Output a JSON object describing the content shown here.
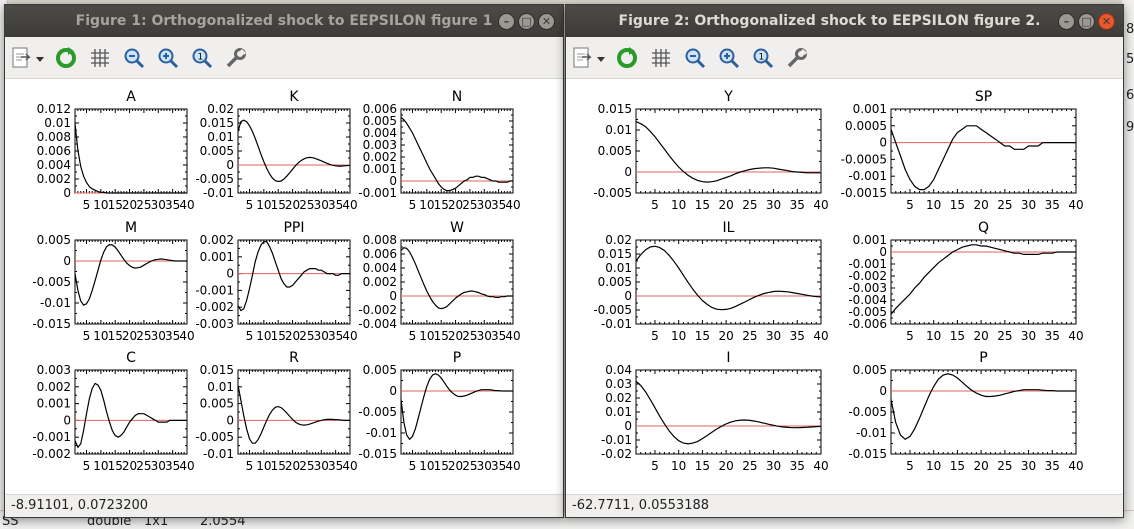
{
  "background": {
    "bottom_text": [
      "SS",
      "double",
      "1x1",
      "2.0554"
    ],
    "right_digits": [
      "8",
      "5",
      "6",
      "9"
    ]
  },
  "windows": [
    {
      "id": "fig1",
      "title": "Figure 1: Orthogonalized shock to EEPSILON figure 1",
      "status": "-8.91101,  0.0723200",
      "active": false
    },
    {
      "id": "fig2",
      "title": "Figure 2: Orthogonalized shock to EEPSILON figure 2.",
      "status": "-62.7711,  0.0553188",
      "active": true
    }
  ],
  "toolbar_icons": [
    "export-icon",
    "dropdown-arrow-icon",
    "refresh-icon",
    "grid-icon",
    "zoom-out-icon",
    "zoom-in-icon",
    "zoom-reset-icon",
    "settings-wrench-icon"
  ],
  "colors": {
    "response": "#000000",
    "zero_line": "#e06060"
  },
  "chart_data": [
    {
      "figure": 1,
      "title": "A",
      "type": "line",
      "x": [
        1,
        40
      ],
      "ylim": [
        0,
        0.012
      ],
      "yticks": [
        "0.012",
        "0.01",
        "0.008",
        "0.006",
        "0.004",
        "0.002",
        "0"
      ],
      "xticks": [
        "5",
        "10",
        "15",
        "20",
        "25",
        "30",
        "35",
        "40"
      ],
      "values": [
        0.0099,
        0.0061,
        0.0038,
        0.0024,
        0.0015,
        0.0009,
        0.0006,
        0.0004,
        0.0002,
        0.0001,
        0.0001,
        0.0,
        0.0,
        0.0,
        0.0,
        0.0,
        0.0,
        0.0,
        0.0,
        0.0,
        0.0,
        0.0,
        0.0,
        0.0,
        0.0,
        0.0,
        0.0,
        0.0,
        0.0,
        0.0,
        0.0,
        0.0,
        0.0,
        0.0,
        0.0,
        0.0,
        0.0,
        0.0,
        0.0,
        0.0
      ]
    },
    {
      "figure": 1,
      "title": "K",
      "type": "line",
      "ylim": [
        -0.01,
        0.02
      ],
      "yticks": [
        "0.02",
        "0.015",
        "0.01",
        "0.005",
        "0",
        "-0.005",
        "-0.01"
      ],
      "xticks": [
        "5",
        "10",
        "15",
        "20",
        "25",
        "30",
        "35",
        "40"
      ],
      "values": [
        0.012,
        0.0155,
        0.016,
        0.0155,
        0.014,
        0.012,
        0.0095,
        0.0067,
        0.0038,
        0.0012,
        -0.0012,
        -0.0032,
        -0.0047,
        -0.0056,
        -0.0059,
        -0.0057,
        -0.005,
        -0.004,
        -0.0028,
        -0.0015,
        -0.0003,
        0.0008,
        0.0016,
        0.0022,
        0.0026,
        0.0027,
        0.0026,
        0.0023,
        0.0019,
        0.0015,
        0.001,
        0.0006,
        0.0002,
        -0.0001,
        -0.0003,
        -0.0004,
        -0.0004,
        -0.0003,
        -0.0002,
        -0.0001
      ]
    },
    {
      "figure": 1,
      "title": "N",
      "type": "line",
      "ylim": [
        -0.001,
        0.006
      ],
      "yticks": [
        "0.006",
        "0.005",
        "0.004",
        "0.003",
        "0.002",
        "0.001",
        "0",
        "-0.001"
      ],
      "xticks": [
        "5",
        "10",
        "15",
        "20",
        "25",
        "30",
        "35",
        "40"
      ],
      "values": [
        0.0053,
        0.0051,
        0.0048,
        0.0044,
        0.004,
        0.0035,
        0.003,
        0.0025,
        0.002,
        0.0015,
        0.001,
        0.0006,
        0.0002,
        -0.0002,
        -0.0005,
        -0.0007,
        -0.0008,
        -0.0008,
        -0.0007,
        -0.0006,
        -0.0004,
        -0.0002,
        0.0,
        0.0001,
        0.0003,
        0.0003,
        0.0004,
        0.0004,
        0.0003,
        0.0003,
        0.0002,
        0.0001,
        0.0,
        0.0,
        -0.0001,
        -0.0001,
        -0.0001,
        -0.0001,
        0.0,
        0.0
      ]
    },
    {
      "figure": 1,
      "title": "M",
      "type": "line",
      "ylim": [
        -0.015,
        0.005
      ],
      "yticks": [
        "0.005",
        "0",
        "-0.005",
        "-0.01",
        "-0.015"
      ],
      "xticks": [
        "5",
        "10",
        "15",
        "20",
        "25",
        "30",
        "35",
        "40"
      ],
      "values": [
        -0.003,
        -0.007,
        -0.0095,
        -0.0105,
        -0.0102,
        -0.009,
        -0.007,
        -0.0047,
        -0.0022,
        0.0002,
        0.0021,
        0.0034,
        0.0039,
        0.0038,
        0.0033,
        0.0024,
        0.0014,
        0.0004,
        -0.0005,
        -0.0011,
        -0.0015,
        -0.0017,
        -0.0016,
        -0.0014,
        -0.001,
        -0.0006,
        -0.0002,
        0.0001,
        0.0003,
        0.0004,
        0.0005,
        0.0004,
        0.0003,
        0.0002,
        0.0001,
        0.0,
        0.0,
        0.0,
        0.0,
        0.0
      ]
    },
    {
      "figure": 1,
      "title": "PPI",
      "type": "line",
      "ylim": [
        -0.003,
        0.002
      ],
      "yticks": [
        "0.002",
        "0.001",
        "0",
        "-0.001",
        "-0.002",
        "-0.003"
      ],
      "xticks": [
        "5",
        "10",
        "15",
        "20",
        "25",
        "30",
        "35",
        "40"
      ],
      "values": [
        -0.0019,
        -0.0022,
        -0.0021,
        -0.0016,
        -0.0009,
        -0.0001,
        0.0007,
        0.0013,
        0.0017,
        0.0019,
        0.0019,
        0.0016,
        0.0012,
        0.0007,
        0.0002,
        -0.0003,
        -0.0006,
        -0.0008,
        -0.0008,
        -0.0007,
        -0.0005,
        -0.0003,
        -0.0001,
        0.0001,
        0.0002,
        0.0003,
        0.0003,
        0.0003,
        0.0002,
        0.0002,
        0.0001,
        0.0,
        0.0,
        0.0,
        -0.0001,
        -0.0001,
        0.0,
        0.0,
        0.0,
        0.0
      ]
    },
    {
      "figure": 1,
      "title": "W",
      "type": "line",
      "ylim": [
        -0.004,
        0.008
      ],
      "yticks": [
        "0.008",
        "0.006",
        "0.004",
        "0.002",
        "0",
        "-0.002",
        "-0.004"
      ],
      "xticks": [
        "5",
        "10",
        "15",
        "20",
        "25",
        "30",
        "35",
        "40"
      ],
      "values": [
        0.0065,
        0.0069,
        0.0068,
        0.0063,
        0.0055,
        0.0046,
        0.0036,
        0.0026,
        0.0016,
        0.0007,
        -0.0001,
        -0.0008,
        -0.0013,
        -0.0017,
        -0.0018,
        -0.0017,
        -0.0015,
        -0.0011,
        -0.0007,
        -0.0003,
        0.0,
        0.0003,
        0.0005,
        0.0006,
        0.0007,
        0.0007,
        0.0006,
        0.0005,
        0.0003,
        0.0002,
        0.0,
        -0.0001,
        -0.0001,
        -0.0002,
        -0.0002,
        -0.0001,
        -0.0001,
        0.0,
        0.0,
        0.0
      ]
    },
    {
      "figure": 1,
      "title": "C",
      "type": "line",
      "ylim": [
        -0.002,
        0.003
      ],
      "yticks": [
        "0.003",
        "0.002",
        "0.001",
        "0",
        "-0.001",
        "-0.002"
      ],
      "xticks": [
        "5",
        "10",
        "15",
        "20",
        "25",
        "30",
        "35",
        "40"
      ],
      "values": [
        -0.0012,
        -0.0016,
        -0.0014,
        -0.0006,
        0.0004,
        0.0013,
        0.0019,
        0.0022,
        0.0021,
        0.0018,
        0.0012,
        0.0005,
        -0.0001,
        -0.0006,
        -0.0009,
        -0.001,
        -0.0009,
        -0.0007,
        -0.0004,
        -0.0001,
        0.0001,
        0.0003,
        0.0004,
        0.0004,
        0.0004,
        0.0003,
        0.0002,
        0.0001,
        0.0,
        -0.0001,
        -0.0001,
        -0.0001,
        -0.0001,
        0.0,
        0.0,
        0.0,
        0.0,
        0.0,
        0.0,
        0.0
      ]
    },
    {
      "figure": 1,
      "title": "R",
      "type": "line",
      "ylim": [
        -0.01,
        0.015
      ],
      "yticks": [
        "0.015",
        "0.01",
        "0.005",
        "0",
        "-0.005",
        "-0.01"
      ],
      "xticks": [
        "5",
        "10",
        "15",
        "20",
        "25",
        "30",
        "35",
        "40"
      ],
      "values": [
        0.0105,
        0.006,
        0.0015,
        -0.0025,
        -0.0055,
        -0.0068,
        -0.0068,
        -0.0057,
        -0.004,
        -0.002,
        0.0,
        0.0018,
        0.0031,
        0.0039,
        0.0041,
        0.0038,
        0.0031,
        0.0022,
        0.0012,
        0.0003,
        -0.0005,
        -0.001,
        -0.0013,
        -0.0014,
        -0.0013,
        -0.0011,
        -0.0008,
        -0.0005,
        -0.0002,
        0.0,
        0.0002,
        0.0003,
        0.0003,
        0.0003,
        0.0002,
        0.0002,
        0.0001,
        0.0,
        0.0,
        0.0
      ]
    },
    {
      "figure": 1,
      "title": "P",
      "type": "line",
      "ylim": [
        -0.015,
        0.005
      ],
      "yticks": [
        "0.005",
        "0",
        "-0.005",
        "-0.01",
        "-0.015"
      ],
      "xticks": [
        "5",
        "10",
        "15",
        "20",
        "25",
        "30",
        "35",
        "40"
      ],
      "values": [
        -0.002,
        -0.0075,
        -0.0105,
        -0.0115,
        -0.0108,
        -0.009,
        -0.0065,
        -0.0038,
        -0.0012,
        0.0011,
        0.0028,
        0.0038,
        0.0041,
        0.0038,
        0.0031,
        0.0021,
        0.0011,
        0.0002,
        -0.0005,
        -0.001,
        -0.0013,
        -0.0013,
        -0.0012,
        -0.001,
        -0.0007,
        -0.0004,
        -0.0001,
        0.0001,
        0.0003,
        0.0003,
        0.0003,
        0.0003,
        0.0002,
        0.0001,
        0.0001,
        0.0,
        0.0,
        0.0,
        0.0,
        0.0
      ]
    },
    {
      "figure": 2,
      "title": "Y",
      "type": "line",
      "ylim": [
        -0.005,
        0.015
      ],
      "yticks": [
        "0.015",
        "0.01",
        "0.005",
        "0",
        "-0.005"
      ],
      "xticks": [
        "5",
        "10",
        "15",
        "20",
        "25",
        "30",
        "35",
        "40"
      ],
      "values": [
        0.012,
        0.0115,
        0.0108,
        0.0097,
        0.0084,
        0.0069,
        0.0054,
        0.0039,
        0.0025,
        0.0012,
        0.0001,
        -0.0008,
        -0.0015,
        -0.002,
        -0.0023,
        -0.0024,
        -0.0023,
        -0.0021,
        -0.0017,
        -0.0013,
        -0.0009,
        -0.0004,
        0.0,
        0.0003,
        0.0006,
        0.0008,
        0.0009,
        0.001,
        0.001,
        0.0009,
        0.0007,
        0.0005,
        0.0003,
        0.0001,
        0.0,
        -0.0001,
        -0.0002,
        -0.0002,
        -0.0002,
        -0.0002
      ]
    },
    {
      "figure": 2,
      "title": "SP",
      "type": "line",
      "ylim": [
        -0.0015,
        0.001
      ],
      "yticks": [
        "0.001",
        "0.0005",
        "0",
        "-0.0005",
        "-0.001",
        "-0.0015"
      ],
      "xticks": [
        "5",
        "10",
        "15",
        "20",
        "25",
        "30",
        "35",
        "40"
      ],
      "values": [
        0.0004,
        0.0,
        -0.0004,
        -0.0008,
        -0.0011,
        -0.0013,
        -0.0014,
        -0.0014,
        -0.0013,
        -0.0011,
        -0.0008,
        -0.0005,
        -0.0002,
        0.0001,
        0.0003,
        0.0004,
        0.0005,
        0.0005,
        0.0005,
        0.0004,
        0.0003,
        0.0002,
        0.0001,
        0.0,
        -0.0001,
        -0.0001,
        -0.0002,
        -0.0002,
        -0.0002,
        -0.0001,
        -0.0001,
        -0.0001,
        0.0,
        0.0,
        0.0,
        0.0,
        0.0,
        0.0,
        0.0,
        0.0
      ]
    },
    {
      "figure": 2,
      "title": "IL",
      "type": "line",
      "ylim": [
        -0.01,
        0.02
      ],
      "yticks": [
        "0.02",
        "0.015",
        "0.01",
        "0.005",
        "0",
        "-0.005",
        "-0.01"
      ],
      "xticks": [
        "5",
        "10",
        "15",
        "20",
        "25",
        "30",
        "35",
        "40"
      ],
      "values": [
        0.0125,
        0.0148,
        0.0165,
        0.0175,
        0.0178,
        0.0173,
        0.0162,
        0.0145,
        0.0124,
        0.01,
        0.0074,
        0.0048,
        0.0024,
        0.0002,
        -0.0016,
        -0.003,
        -0.0041,
        -0.0047,
        -0.0049,
        -0.0048,
        -0.0044,
        -0.0037,
        -0.0029,
        -0.0021,
        -0.0012,
        -0.0004,
        0.0003,
        0.0009,
        0.0013,
        0.0016,
        0.0017,
        0.0016,
        0.0015,
        0.0012,
        0.0009,
        0.0006,
        0.0003,
        0.0,
        -0.0002,
        -0.0003
      ]
    },
    {
      "figure": 2,
      "title": "Q",
      "type": "line",
      "ylim": [
        -0.006,
        0.001
      ],
      "yticks": [
        "0.001",
        "0",
        "-0.001",
        "-0.002",
        "-0.003",
        "-0.004",
        "-0.005",
        "-0.006"
      ],
      "xticks": [
        "5",
        "10",
        "15",
        "20",
        "25",
        "30",
        "35",
        "40"
      ],
      "values": [
        -0.0052,
        -0.0047,
        -0.0043,
        -0.0039,
        -0.0035,
        -0.003,
        -0.0026,
        -0.0021,
        -0.0017,
        -0.0013,
        -0.0009,
        -0.0006,
        -0.0003,
        0.0,
        0.0002,
        0.0004,
        0.0005,
        0.0006,
        0.0006,
        0.0005,
        0.0005,
        0.0004,
        0.0003,
        0.0002,
        0.0001,
        0.0,
        -0.0001,
        -0.0001,
        -0.0002,
        -0.0002,
        -0.0002,
        -0.0002,
        -0.0001,
        -0.0001,
        -0.0001,
        0.0,
        0.0,
        0.0,
        0.0,
        0.0
      ]
    },
    {
      "figure": 2,
      "title": "I",
      "type": "line",
      "ylim": [
        -0.02,
        0.04
      ],
      "yticks": [
        "0.04",
        "0.03",
        "0.02",
        "0.01",
        "0",
        "-0.01",
        "-0.02"
      ],
      "xticks": [
        "5",
        "10",
        "15",
        "20",
        "25",
        "30",
        "35",
        "40"
      ],
      "values": [
        0.032,
        0.029,
        0.0245,
        0.019,
        0.013,
        0.007,
        0.0015,
        -0.0035,
        -0.0075,
        -0.0105,
        -0.0122,
        -0.0128,
        -0.0122,
        -0.011,
        -0.009,
        -0.0068,
        -0.0045,
        -0.0022,
        -0.0002,
        0.0015,
        0.0028,
        0.0037,
        0.0042,
        0.0043,
        0.004,
        0.0035,
        0.0028,
        0.002,
        0.0012,
        0.0005,
        -0.0002,
        -0.0007,
        -0.001,
        -0.0012,
        -0.0012,
        -0.0011,
        -0.0009,
        -0.0007,
        -0.0004,
        -0.0002
      ]
    },
    {
      "figure": 2,
      "title": "P",
      "type": "line",
      "ylim": [
        -0.015,
        0.005
      ],
      "yticks": [
        "0.005",
        "0",
        "-0.005",
        "-0.01",
        "-0.015"
      ],
      "xticks": [
        "5",
        "10",
        "15",
        "20",
        "25",
        "30",
        "35",
        "40"
      ],
      "values": [
        -0.002,
        -0.0075,
        -0.0105,
        -0.0115,
        -0.0108,
        -0.009,
        -0.0065,
        -0.0038,
        -0.0012,
        0.0011,
        0.0028,
        0.0038,
        0.0041,
        0.0038,
        0.0031,
        0.0021,
        0.0011,
        0.0002,
        -0.0005,
        -0.001,
        -0.0013,
        -0.0013,
        -0.0012,
        -0.001,
        -0.0007,
        -0.0004,
        -0.0001,
        0.0001,
        0.0003,
        0.0003,
        0.0003,
        0.0003,
        0.0002,
        0.0001,
        0.0001,
        0.0,
        0.0,
        0.0,
        0.0,
        0.0
      ]
    }
  ]
}
